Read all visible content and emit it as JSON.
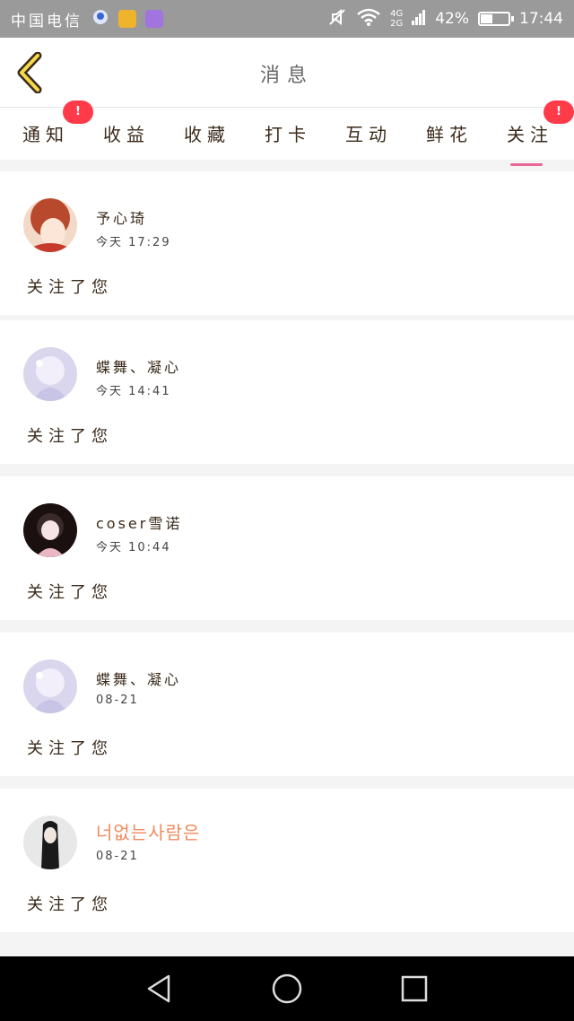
{
  "status_bar": {
    "carrier": "中国电信",
    "network_top": "4G",
    "network_bottom": "2G",
    "battery": "42%",
    "battery_level": 0.42,
    "time": "17:44"
  },
  "header": {
    "title": "消息"
  },
  "tabs": [
    {
      "label": "通知",
      "badge": "!"
    },
    {
      "label": "收益"
    },
    {
      "label": "收藏"
    },
    {
      "label": "打卡"
    },
    {
      "label": "互动"
    },
    {
      "label": "鲜花"
    },
    {
      "label": "关注",
      "badge": "!",
      "active": true
    }
  ],
  "messages": [
    {
      "name": "予心琦",
      "time": "今天 17:29",
      "text": "关注了您"
    },
    {
      "name": "蝶舞、凝心",
      "time": "今天 14:41",
      "text": "关注了您"
    },
    {
      "name": "coser雪诺",
      "time": "今天 10:44",
      "text": "关注了您"
    },
    {
      "name": "蝶舞、凝心",
      "time": "08-21",
      "text": "关注了您"
    },
    {
      "name": "너없는사람은",
      "time": "08-21",
      "text": "关注了您"
    }
  ],
  "colors": {
    "accent_pink": "#e8679b",
    "badge_red": "#ff3b4a",
    "korean_name": "#f08a5d",
    "back_arrow_fill": "#f5d94a"
  }
}
